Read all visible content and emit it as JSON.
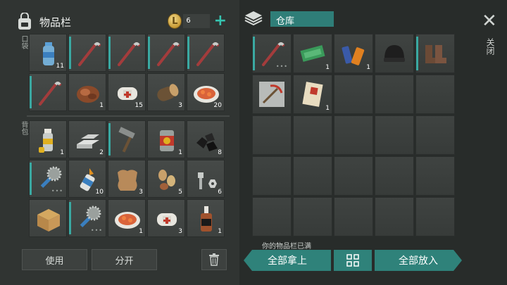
{
  "inventory": {
    "title": "物品栏",
    "coins": "6",
    "plus_symbol": "+",
    "pocket_label": "口袋",
    "backpack_label": "背包",
    "use_button": "使用",
    "split_button": "分开",
    "pocket_slots": [
      {
        "icon": "water-bottle-icon",
        "count": "11",
        "durability": false
      },
      {
        "icon": "crowbar-icon",
        "count": "",
        "durability": true
      },
      {
        "icon": "crowbar-icon",
        "count": "",
        "durability": true
      },
      {
        "icon": "crowbar-icon",
        "count": "",
        "durability": true
      },
      {
        "icon": "crowbar-icon",
        "count": "",
        "durability": true
      },
      {
        "icon": "crowbar-icon",
        "count": "",
        "durability": true
      },
      {
        "icon": "raw-meat-icon",
        "count": "1",
        "durability": false
      },
      {
        "icon": "bandage-icon",
        "count": "15",
        "durability": false
      },
      {
        "icon": "wood-log-icon",
        "count": "3",
        "durability": false
      },
      {
        "icon": "food-plate-icon",
        "count": "20",
        "durability": false
      }
    ],
    "backpack_slots": [
      {
        "icon": "spray-can-icon",
        "count": "1",
        "durability": false
      },
      {
        "icon": "iron-bars-icon",
        "count": "2",
        "durability": false
      },
      {
        "icon": "hammer-icon",
        "count": "",
        "durability": true
      },
      {
        "icon": "canned-food-icon",
        "count": "1",
        "durability": false
      },
      {
        "icon": "coal-icon",
        "count": "8",
        "durability": false
      },
      {
        "icon": "saw-bat-icon",
        "count": "",
        "durability": true,
        "dots": true
      },
      {
        "icon": "glue-icon",
        "count": "10",
        "durability": false
      },
      {
        "icon": "leather-icon",
        "count": "3",
        "durability": false
      },
      {
        "icon": "seeds-icon",
        "count": "5",
        "durability": false
      },
      {
        "icon": "bolts-icon",
        "count": "6",
        "durability": false
      },
      {
        "icon": "cardboard-box-icon",
        "count": "",
        "durability": false
      },
      {
        "icon": "saw-bat-icon",
        "count": "",
        "durability": true,
        "dots": true
      },
      {
        "icon": "food-plate-icon",
        "count": "1",
        "durability": false
      },
      {
        "icon": "bandage-icon",
        "count": "3",
        "durability": false
      },
      {
        "icon": "whiskey-bottle-icon",
        "count": "1",
        "durability": false
      }
    ]
  },
  "storage": {
    "title": "仓库",
    "close_label": "关闭",
    "full_message": "你的物品栏已满",
    "take_all": "全部拿上",
    "put_all": "全部放入",
    "slots": [
      {
        "icon": "crowbar-icon",
        "count": "",
        "durability": true,
        "dots": true
      },
      {
        "icon": "coupon-icon",
        "count": "1",
        "durability": false
      },
      {
        "icon": "batteries-icon",
        "count": "1",
        "durability": false
      },
      {
        "icon": "beanie-hat-icon",
        "count": "",
        "durability": false
      },
      {
        "icon": "boots-icon",
        "count": "",
        "durability": true
      },
      {
        "icon": "pickaxe-blueprint-icon",
        "count": "",
        "durability": false
      },
      {
        "icon": "recipe-note-icon",
        "count": "1",
        "durability": false
      }
    ],
    "total_slots": 25
  },
  "colors": {
    "accent": "#2f827a",
    "durability": "#3aa9a2",
    "plus": "#35c4b0"
  }
}
